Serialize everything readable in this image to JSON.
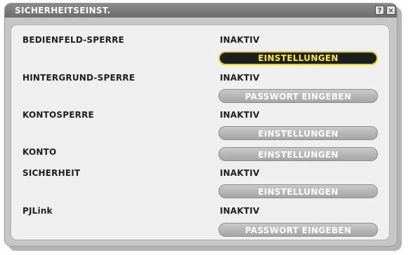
{
  "window": {
    "title": "SICHERHEITSEINST.",
    "help_label": "?",
    "close_label": "×"
  },
  "rows": [
    {
      "label": "BEDIENFELD-SPERRE",
      "value": "INAKTIV",
      "button": "EINSTELLUNGEN",
      "button_selected": true
    },
    {
      "label": "HINTERGRUND-SPERRE",
      "value": "INAKTIV",
      "button": "PASSWORT EINGEBEN",
      "button_selected": false
    },
    {
      "label": "KONTOSPERRE",
      "value": "INAKTIV",
      "button": "EINSTELLUNGEN",
      "button_selected": false
    },
    {
      "label": "KONTO",
      "value": "",
      "button": "EINSTELLUNGEN",
      "button_selected": false
    },
    {
      "label": "SICHERHEIT",
      "value": "INAKTIV",
      "button": "EINSTELLUNGEN",
      "button_selected": false
    },
    {
      "label": "PJLink",
      "value": "INAKTIV",
      "button": "PASSWORT EINGEBEN",
      "button_selected": false
    }
  ],
  "colors": {
    "selected_button_text": "#ffe733",
    "selected_button_border": "#e8d21c",
    "selected_button_bg": "#1e1e1e",
    "button_bg": "#b0b0b0",
    "panel_bg": "#efefef",
    "titlebar_bg": "#7a7a7a"
  }
}
